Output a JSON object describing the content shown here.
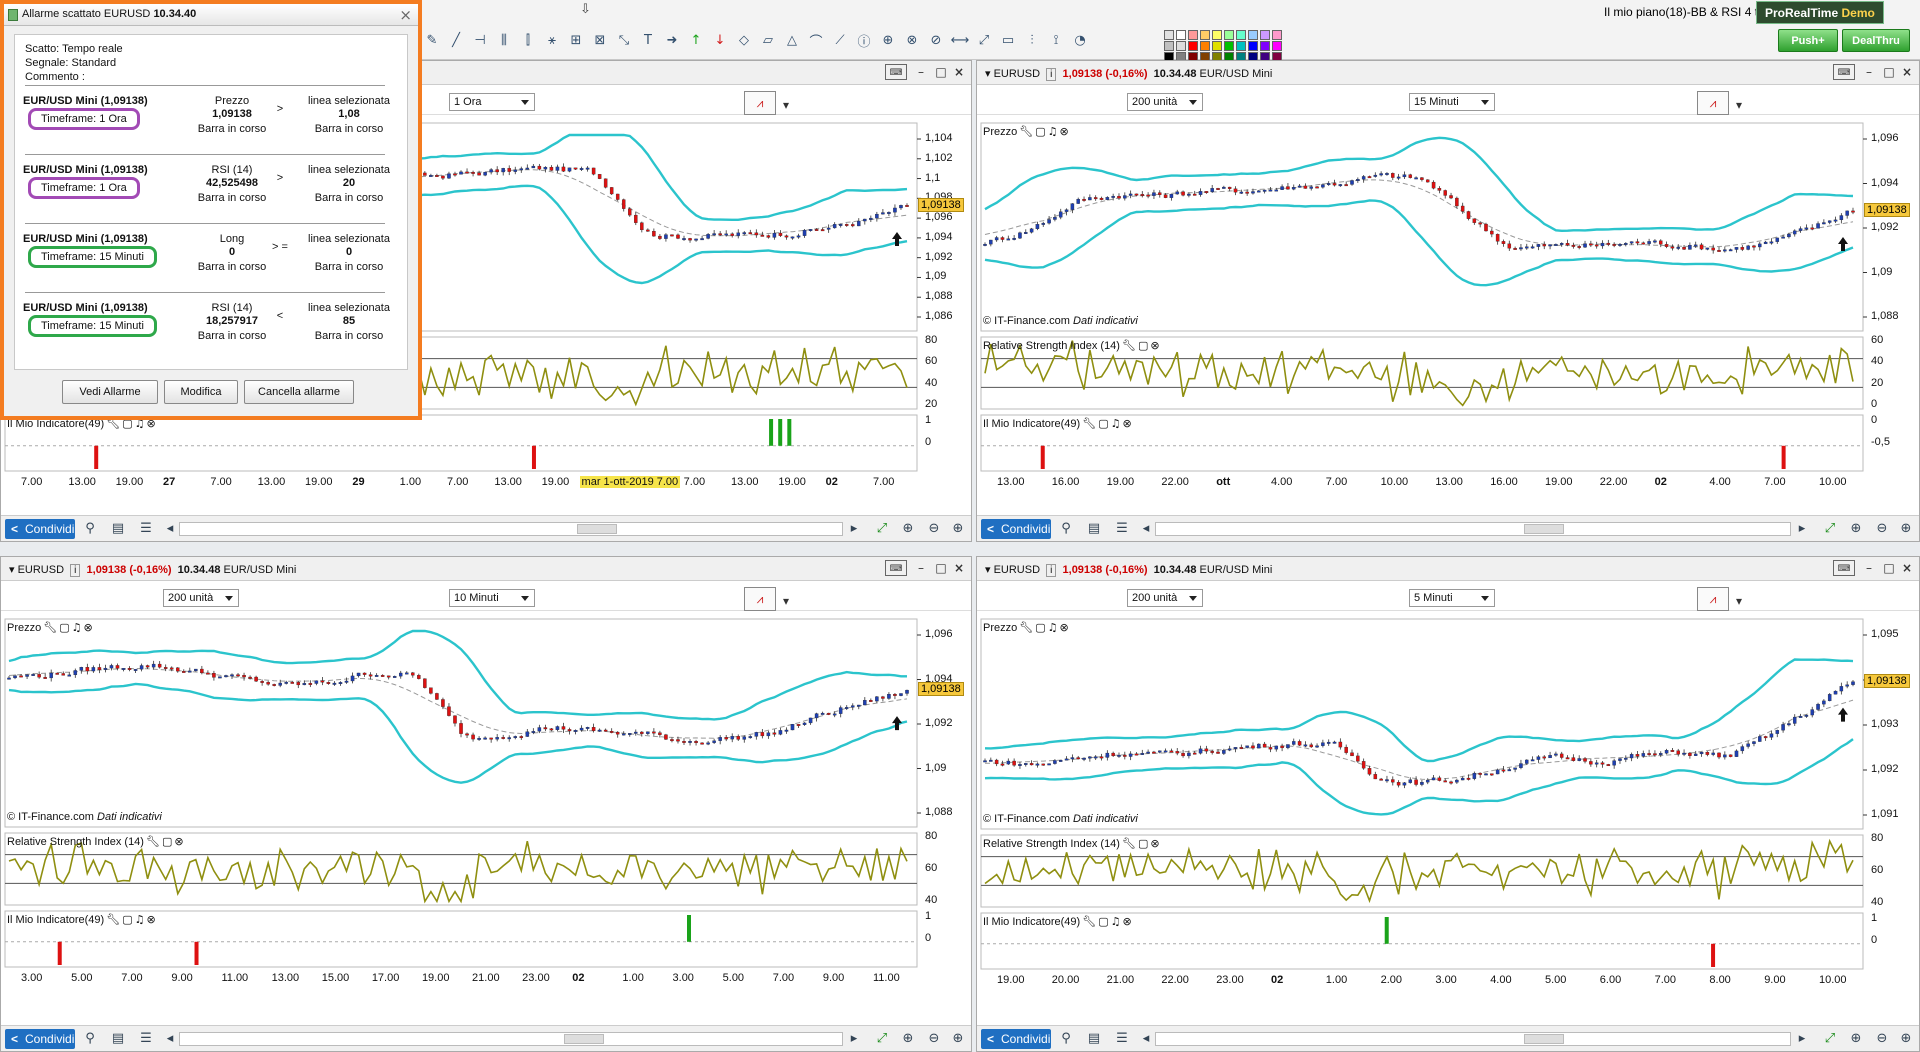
{
  "toolbar": {
    "title": "Il mio piano(18)-BB & RSI 4 tf",
    "badge_a": "ProRealTime",
    "badge_b": "Demo",
    "push_label": "Push+",
    "dealthru_label": "DealThru",
    "colors": [
      "#e0e0e0",
      "#ffffff",
      "#ff9999",
      "#ffcc66",
      "#ffff66",
      "#99ff99",
      "#66ffcc",
      "#99ccff",
      "#cc99ff",
      "#ff99cc",
      "#c0c0c0",
      "#dddddd",
      "#ff0000",
      "#ff8000",
      "#e0e000",
      "#00c000",
      "#00c0c0",
      "#0000ff",
      "#8000ff",
      "#ff00ff",
      "#000000",
      "#808080",
      "#800000",
      "#804000",
      "#808000",
      "#008000",
      "#008080",
      "#000080",
      "#400080",
      "#800040"
    ]
  },
  "alarm": {
    "title": "Allarme scattato  EURUSD",
    "time": "10.34.40",
    "info": [
      "Scatto: Tempo reale",
      "Segnale: Standard",
      "Commento :"
    ],
    "rows": [
      {
        "symbol": "EUR/USD Mini (1,09138)",
        "timeframe": "Timeframe: 1 Ora",
        "tf_color": "#a24ab5",
        "c1a": "Prezzo",
        "c1b": "1,09138",
        "c1c": "Barra in corso",
        "op": ">",
        "c3a": "linea selezionata",
        "c3b": "1,08",
        "c3c": "Barra in corso"
      },
      {
        "symbol": "EUR/USD Mini (1,09138)",
        "timeframe": "Timeframe: 1 Ora",
        "tf_color": "#a24ab5",
        "c1a": "RSI (14)",
        "c1b": "42,525498",
        "c1c": "Barra in corso",
        "op": ">",
        "c3a": "linea selezionata",
        "c3b": "20",
        "c3c": "Barra in corso"
      },
      {
        "symbol": "EUR/USD Mini (1,09138)",
        "timeframe": "Timeframe: 15 Minuti",
        "tf_color": "#2ea84a",
        "c1a": "Long",
        "c1b": "0",
        "c1c": "Barra in corso",
        "op": "> =",
        "c3a": "linea selezionata",
        "c3b": "0",
        "c3c": "Barra in corso"
      },
      {
        "symbol": "EUR/USD Mini (1,09138)",
        "timeframe": "Timeframe: 15 Minuti",
        "tf_color": "#2ea84a",
        "c1a": "RSI (14)",
        "c1b": "18,257917",
        "c1c": "Barra in corso",
        "op": "<",
        "c3a": "linea selezionata",
        "c3b": "85",
        "c3c": "Barra in corso"
      }
    ],
    "buttons": {
      "view": "Vedi Allarme",
      "edit": "Modifica",
      "delete": "Cancella allarme"
    }
  },
  "common": {
    "symbol": "EURUSD",
    "price_change": "1,09138 (-0,16%)",
    "time": "10.34.48",
    "instrument": "EUR/USD Mini",
    "price_tag": "1,09138",
    "share_label": "Condividi",
    "copyright": "© IT-Finance.com",
    "copyright_note": "Dati indicativi",
    "price_label": "Prezzo",
    "rsi_label": "Relative Strength Index (14)",
    "ind_label": "Il Mio Indicatore(49)"
  },
  "panels": [
    {
      "units": "",
      "timeframe": "1 Ora",
      "bg": "#ffffff",
      "price_ticks": [
        "1,104",
        "1,102",
        "1,1",
        "1,098",
        "1,096",
        "1,094",
        "1,092",
        "1,09",
        "1,088",
        "1,086"
      ],
      "rsi_ticks": [
        "80",
        "60",
        "40",
        "20"
      ],
      "ind_ticks": [
        "1",
        "0"
      ],
      "x_ticks": [
        {
          "t": "7.00",
          "b": false
        },
        {
          "t": "13.00",
          "b": false
        },
        {
          "t": "19.00",
          "b": false
        },
        {
          "t": "27",
          "b": true
        },
        {
          "t": "7.00",
          "b": false
        },
        {
          "t": "13.00",
          "b": false
        },
        {
          "t": "19.00",
          "b": false
        },
        {
          "t": "29",
          "b": true
        },
        {
          "t": "1.00",
          "b": false
        },
        {
          "t": "7.00",
          "b": false
        },
        {
          "t": "13.00",
          "b": false
        },
        {
          "t": "19.00",
          "b": false
        },
        {
          "t": "ott",
          "b": true
        },
        {
          "t": "1.00",
          "b": false
        },
        {
          "t": "7.00",
          "b": false
        },
        {
          "t": "13.00",
          "b": false
        },
        {
          "t": "19.00",
          "b": false
        },
        {
          "t": "02",
          "b": true
        },
        {
          "t": "7.00",
          "b": false
        }
      ],
      "cursor_label": "mar 1-ott-2019 7.00"
    },
    {
      "units": "200 unità",
      "timeframe": "15 Minuti",
      "bg": "#ffffff",
      "price_ticks": [
        "1,096",
        "1,094",
        "1,092",
        "1,09",
        "1,088"
      ],
      "rsi_ticks": [
        "60",
        "40",
        "20",
        "0"
      ],
      "ind_ticks": [
        "0",
        "-0,5"
      ],
      "x_ticks": [
        {
          "t": "13.00",
          "b": false
        },
        {
          "t": "16.00",
          "b": false
        },
        {
          "t": "19.00",
          "b": false
        },
        {
          "t": "22.00",
          "b": false
        },
        {
          "t": "ott",
          "b": true
        },
        {
          "t": "4.00",
          "b": false
        },
        {
          "t": "7.00",
          "b": false
        },
        {
          "t": "10.00",
          "b": false
        },
        {
          "t": "13.00",
          "b": false
        },
        {
          "t": "16.00",
          "b": false
        },
        {
          "t": "19.00",
          "b": false
        },
        {
          "t": "22.00",
          "b": false
        },
        {
          "t": "02",
          "b": true
        },
        {
          "t": "4.00",
          "b": false
        },
        {
          "t": "7.00",
          "b": false
        },
        {
          "t": "10.00",
          "b": false
        }
      ]
    },
    {
      "units": "200 unità",
      "timeframe": "10 Minuti",
      "bg": "#ffffff",
      "price_ticks": [
        "1,096",
        "1,094",
        "1,092",
        "1,09",
        "1,088"
      ],
      "rsi_ticks": [
        "80",
        "60",
        "40"
      ],
      "ind_ticks": [
        "1",
        "0"
      ],
      "x_ticks": [
        {
          "t": "3.00",
          "b": false
        },
        {
          "t": "5.00",
          "b": false
        },
        {
          "t": "7.00",
          "b": false
        },
        {
          "t": "9.00",
          "b": false
        },
        {
          "t": "11.00",
          "b": false
        },
        {
          "t": "13.00",
          "b": false
        },
        {
          "t": "15.00",
          "b": false
        },
        {
          "t": "17.00",
          "b": false
        },
        {
          "t": "19.00",
          "b": false
        },
        {
          "t": "21.00",
          "b": false
        },
        {
          "t": "23.00",
          "b": false
        },
        {
          "t": "02",
          "b": true
        },
        {
          "t": "1.00",
          "b": false
        },
        {
          "t": "3.00",
          "b": false
        },
        {
          "t": "5.00",
          "b": false
        },
        {
          "t": "7.00",
          "b": false
        },
        {
          "t": "9.00",
          "b": false
        },
        {
          "t": "11.00",
          "b": false
        }
      ]
    },
    {
      "units": "200 unità",
      "timeframe": "5 Minuti",
      "bg": "#ffffff",
      "price_ticks": [
        "1,095",
        "1,094",
        "1,093",
        "1,092",
        "1,091"
      ],
      "rsi_ticks": [
        "80",
        "60",
        "40"
      ],
      "ind_ticks": [
        "1",
        "0"
      ],
      "x_ticks": [
        {
          "t": "19.00",
          "b": false
        },
        {
          "t": "20.00",
          "b": false
        },
        {
          "t": "21.00",
          "b": false
        },
        {
          "t": "22.00",
          "b": false
        },
        {
          "t": "23.00",
          "b": false
        },
        {
          "t": "02",
          "b": true
        },
        {
          "t": "1.00",
          "b": false
        },
        {
          "t": "2.00",
          "b": false
        },
        {
          "t": "3.00",
          "b": false
        },
        {
          "t": "4.00",
          "b": false
        },
        {
          "t": "5.00",
          "b": false
        },
        {
          "t": "6.00",
          "b": false
        },
        {
          "t": "7.00",
          "b": false
        },
        {
          "t": "8.00",
          "b": false
        },
        {
          "t": "9.00",
          "b": false
        },
        {
          "t": "10.00",
          "b": false
        }
      ]
    }
  ]
}
